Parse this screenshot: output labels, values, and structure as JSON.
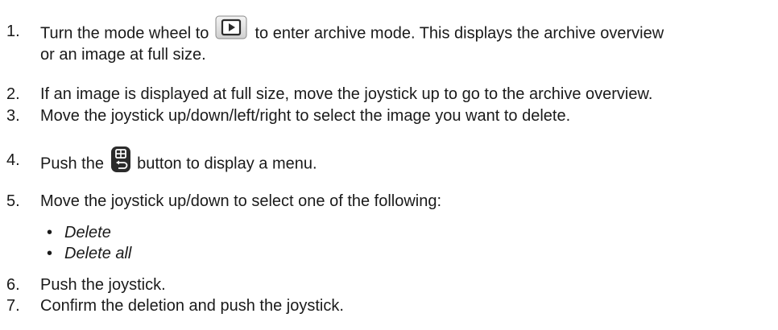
{
  "steps": [
    {
      "number": "1.",
      "before": "Turn the mode wheel to",
      "icon": "archive-mode-icon",
      "after": "to enter archive mode. This displays the archive overview",
      "continuation": "or an image at full size."
    },
    {
      "number": "2.",
      "text": "If an image is displayed at full size, move the joystick up to go to the archive overview."
    },
    {
      "number": "3.",
      "text": "Move the joystick up/down/left/right to select the image you want to delete."
    },
    {
      "number": "4.",
      "before": "Push the",
      "icon": "menu-back-button-icon",
      "after": "button to display a menu."
    },
    {
      "number": "5.",
      "text": "Move the joystick up/down to select one of the following:",
      "options": [
        "Delete",
        "Delete all"
      ]
    },
    {
      "number": "6.",
      "text": "Push the joystick."
    },
    {
      "number": "7.",
      "text": "Confirm the deletion and push the joystick."
    }
  ],
  "bullet_glyph": "•",
  "colors": {
    "text": "#1a1a1a",
    "icon_dark": "#2b2b2b",
    "icon_light": "#e8e8e8"
  }
}
